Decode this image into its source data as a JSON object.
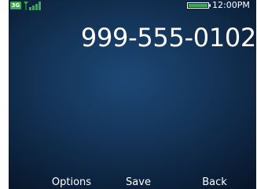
{
  "status_bar": {
    "network_badge": "3G",
    "signal_icon": "signal-strength-icon",
    "battery_icon": "battery-full-icon",
    "time": "12:00PM",
    "colors": {
      "network_badge": "#2fb14a",
      "signal": "#2fb14a",
      "battery": "#2fb14a"
    },
    "signal_level_bars": 4,
    "battery_level": 1.0
  },
  "dialer": {
    "number": "999-555-0102"
  },
  "softkeys": {
    "left": "Options",
    "center": "Save",
    "right": "Back"
  }
}
